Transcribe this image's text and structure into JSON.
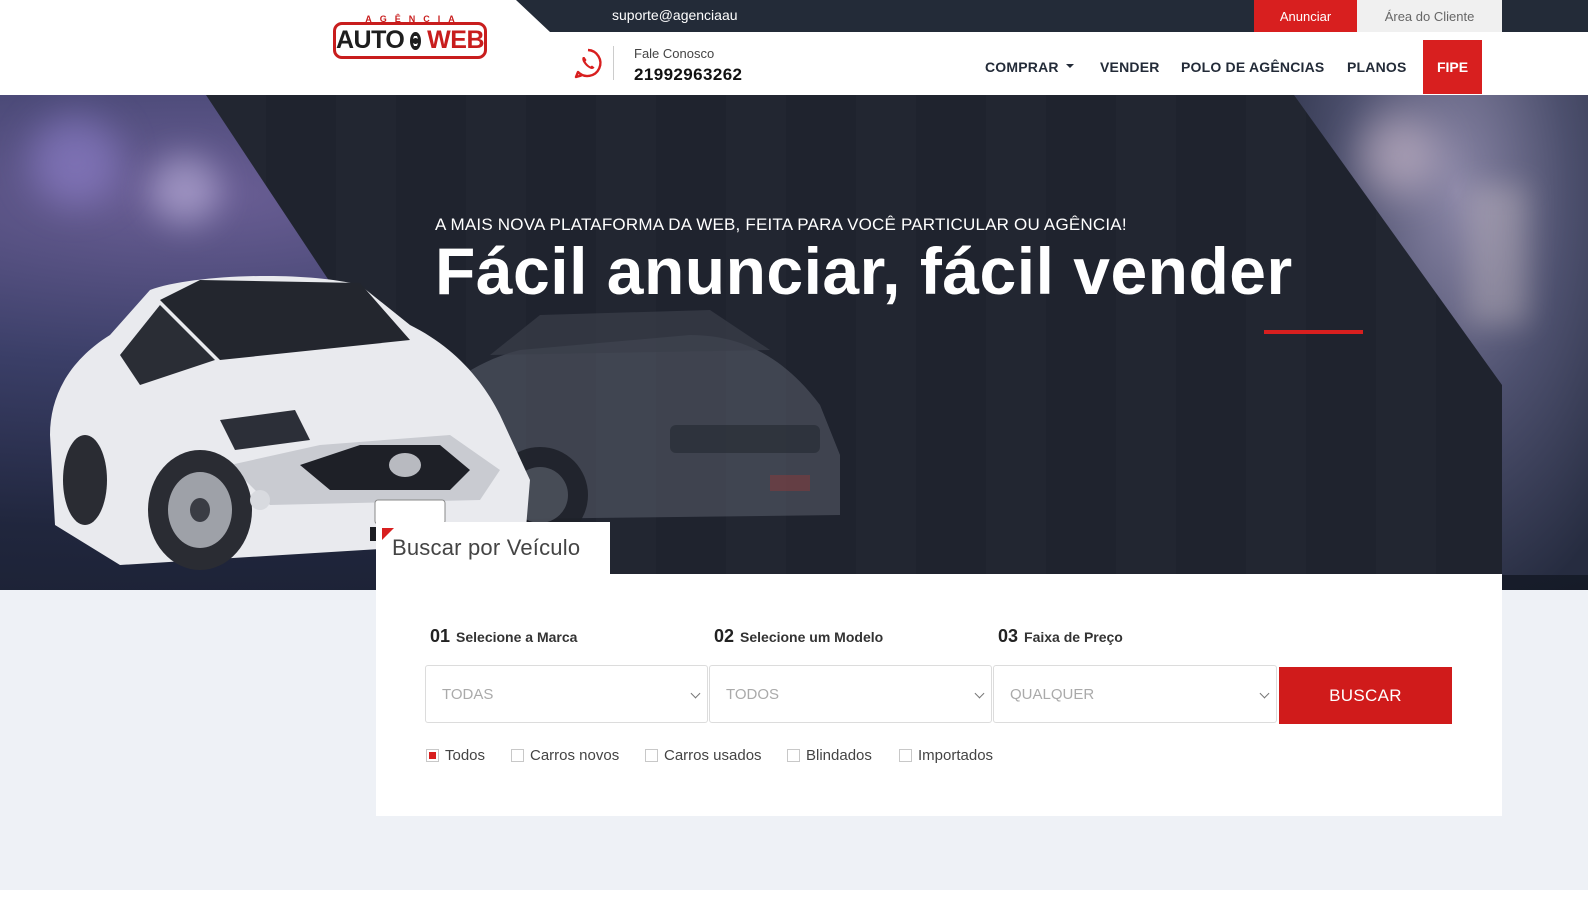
{
  "topbar": {
    "email": "suporte@agenciaau",
    "anunciar_label": "Anunciar",
    "area_cliente_label": "Área do Cliente"
  },
  "logo": {
    "top_text": "AGÊNCIA",
    "auto_text": "AUTO",
    "web_text": "WEB"
  },
  "contact": {
    "label": "Fale Conosco",
    "phone": "21992963262"
  },
  "nav": {
    "comprar": "COMPRAR",
    "vender": "VENDER",
    "polo": "POLO DE AGÊNCIAS",
    "planos": "PLANOS",
    "fipe": "FIPE"
  },
  "hero": {
    "subtitle": "A MAIS NOVA PLATAFORMA DA WEB, FEITA PARA VOCÊ PARTICULAR OU AGÊNCIA!",
    "title": "Fácil anunciar, fácil vender"
  },
  "search": {
    "tab_label": "Buscar por Veículo",
    "steps": [
      {
        "num": "01",
        "label": "Selecione a Marca",
        "selected": "TODAS"
      },
      {
        "num": "02",
        "label": "Selecione um Modelo",
        "selected": "TODOS"
      },
      {
        "num": "03",
        "label": "Faixa de Preço",
        "selected": "QUALQUER"
      }
    ],
    "button_label": "BUSCAR",
    "filters": [
      {
        "label": "Todos",
        "checked": true
      },
      {
        "label": "Carros novos",
        "checked": false
      },
      {
        "label": "Carros usados",
        "checked": false
      },
      {
        "label": "Blindados",
        "checked": false
      },
      {
        "label": "Importados",
        "checked": false
      }
    ]
  },
  "colors": {
    "accent": "#d81f1f",
    "dark": "#232b38",
    "background": "#eef1f6"
  }
}
